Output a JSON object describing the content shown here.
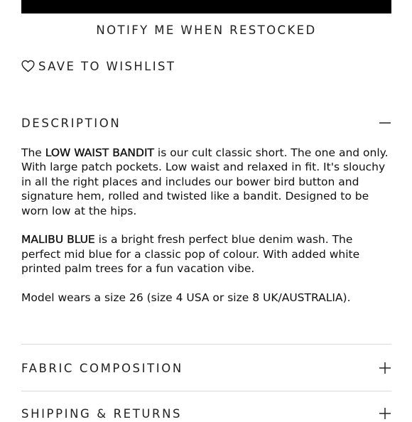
{
  "notify_button": "NOTIFY ME WHEN RESTOCKED",
  "wishlist": {
    "label": "SAVE TO WISHLIST",
    "icon": "heart-outline-icon"
  },
  "description": {
    "title": "DESCRIPTION",
    "toggle_icon": "minus-icon",
    "p1": {
      "prefix": "The ",
      "highlight": "LOW WAIST BANDIT",
      "rest": " is our cult classic short. The one and only. With large patch pockets. Low waist and relaxed in fit. It's slouchy in all the right places and includes our bower bird button and signature hem, rolled and twisted like a bandit. Designed to be worn low at the hips."
    },
    "p2": {
      "highlight": "MALIBU BLUE",
      "rest": " is a bright fresh perfect blue denim wash. The perfect mid blue for a classic pop of colour. With added white printed palm trees for a fun vacation vibe."
    },
    "p3": "Model wears a size 26 (size 4 USA or size 8 UK/AUSTRALIA)."
  },
  "fabric": {
    "title": "FABRIC COMPOSITION",
    "toggle_icon": "plus-icon"
  },
  "shipping": {
    "title": "SHIPPING & RETURNS",
    "toggle_icon": "plus-icon"
  },
  "colors": {
    "divider": "#d9d9d9",
    "text": "#111111",
    "bar": "#000000"
  }
}
